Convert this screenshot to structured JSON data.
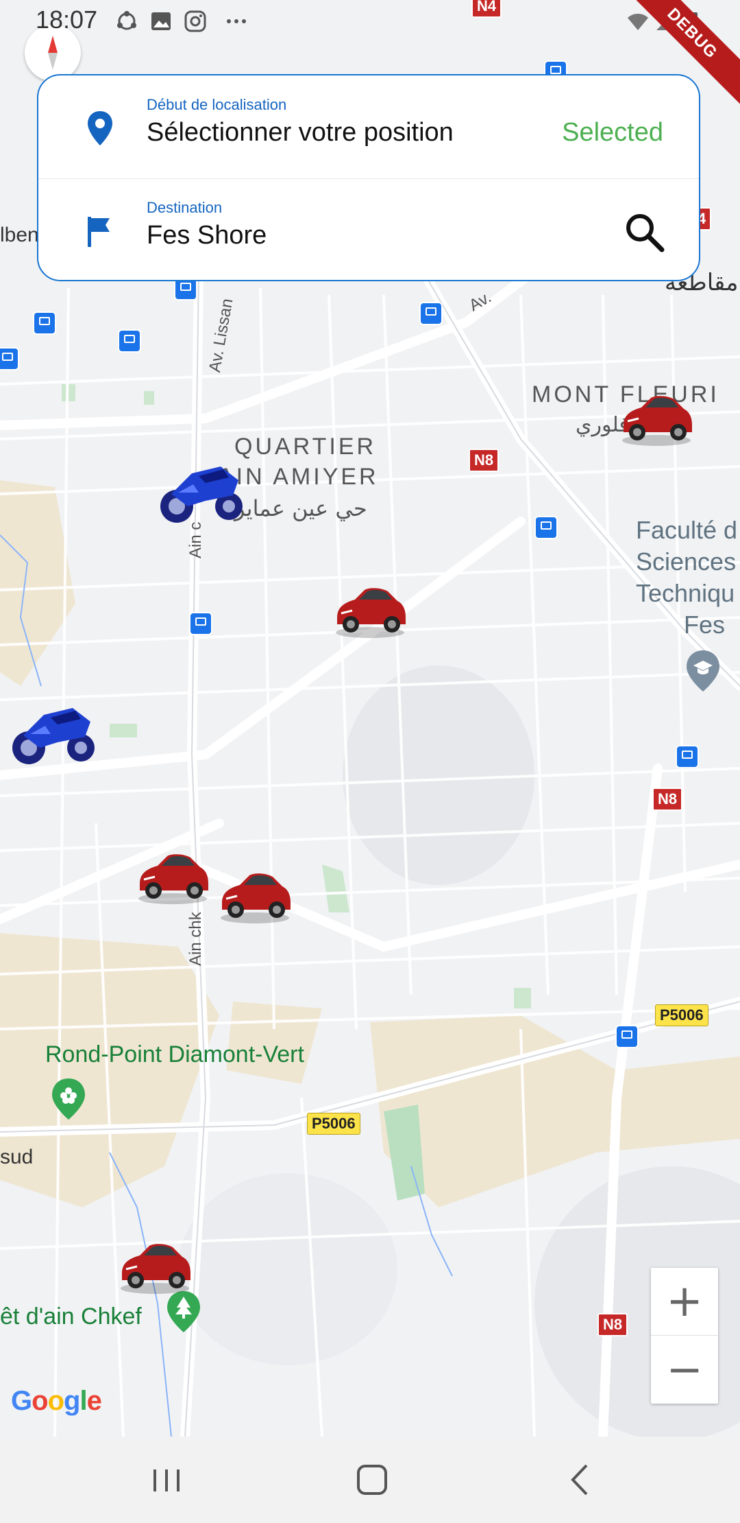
{
  "status_bar": {
    "time": "18:07",
    "icons": [
      "sync-icon",
      "gallery-icon",
      "instagram-icon",
      "more-icon"
    ],
    "right_icons": [
      "wifi-icon",
      "signal-icon",
      "battery-icon"
    ]
  },
  "debug_banner": "DEBUG",
  "search_card": {
    "start": {
      "label": "Début de localisation",
      "value": "Sélectionner votre position",
      "status": "Selected",
      "icon": "location-pin-icon"
    },
    "destination": {
      "label": "Destination",
      "value": "Fes Shore",
      "icon": "flag-icon",
      "action_icon": "search-icon"
    }
  },
  "map": {
    "labels": {
      "quartier1": "QUARTIER",
      "quartier2": "AIN AMIYER",
      "quartier_ar": "حي عين عماير",
      "mont": "MONT FLEURI",
      "mont_ar": "فلوري",
      "faculte1": "Faculté d",
      "faculte2": "Sciences",
      "faculte3": "Techniqu",
      "faculte4": "Fes",
      "rondpoint": "Rond-Point Diamont-Vert",
      "foret": "êt d'ain Chkef",
      "ar_top": "مقاطعه",
      "albert": "lben",
      "sud": "sud",
      "lissan": "Av. Lissan",
      "ainc1": "Ain c",
      "ainc2": "Ain chk",
      "av": "Av."
    },
    "road_shields": {
      "n4": "N4",
      "n8a": "N8",
      "n8b": "N8",
      "n8c": "N8",
      "n4b": "4"
    },
    "yellow_shields": {
      "p1": "P5006",
      "p2": "P5006"
    },
    "vehicles": [
      "red-car",
      "red-car",
      "red-car",
      "red-car",
      "red-car",
      "blue-motorcycle",
      "blue-motorcycle"
    ],
    "google_logo": "Google"
  },
  "zoom": {
    "in": "+",
    "out": "−"
  },
  "nav_bar": {
    "icons": [
      "recent-apps-icon",
      "home-icon",
      "back-icon"
    ]
  },
  "colors": {
    "accent": "#1976d2",
    "selected": "#4caf50",
    "label_blue": "#1565c0",
    "road_shield": "#c62828"
  }
}
